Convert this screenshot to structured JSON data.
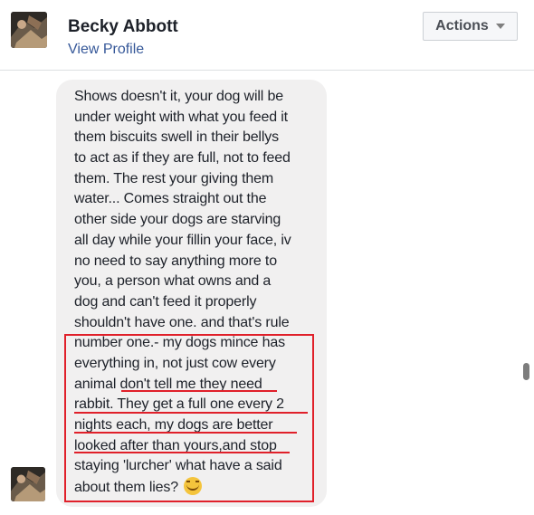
{
  "header": {
    "name": "Becky Abbott",
    "view_profile": "View Profile",
    "actions_label": "Actions"
  },
  "message": {
    "lines": [
      "Shows doesn't it, your dog will be",
      "under weight with what you feed it",
      "them biscuits swell in their bellys",
      "to act as if they are full, not to feed",
      "them. The rest your giving them",
      "water... Comes straight out the",
      "other side your dogs are starving",
      "all day while your fillin your face, iv",
      "no need to say anything more to",
      "you, a person what owns and a",
      "dog and can't feed it properly",
      "shouldn't have one. and that's rule",
      "number one.- my dogs mince has",
      "everything in, not just cow every",
      "animal don't tell me they need",
      "rabbit. They get a full one every 2",
      "nights each, my dogs are better",
      "looked after than yours,and stop",
      "staying 'lurcher' what have a said",
      "about them lies?"
    ]
  },
  "colors": {
    "link": "#365899",
    "bubble": "#f1f0f0",
    "annotation": "#e0202a"
  }
}
